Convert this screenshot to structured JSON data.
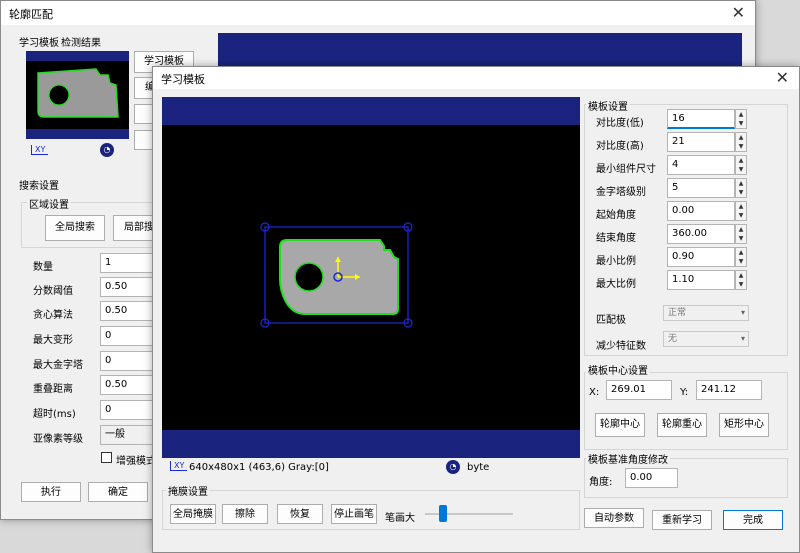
{
  "back_window": {
    "title": "轮廓匹配",
    "tabs": [
      "学习模板",
      "检测结果"
    ],
    "buttons": {
      "learn_template": "学习模板",
      "edit": "编"
    },
    "search_group": "搜索设置",
    "region_group": "区域设置",
    "global_search": "全局搜索",
    "local_search": "局部搜",
    "params": [
      {
        "label": "数量",
        "value": "1"
      },
      {
        "label": "分数阈值",
        "value": "0.50"
      },
      {
        "label": "贪心算法",
        "value": "0.50"
      },
      {
        "label": "最大变形",
        "value": "0"
      },
      {
        "label": "最大金字塔",
        "value": "0"
      },
      {
        "label": "重叠距离",
        "value": "0.50"
      },
      {
        "label": "超时(ms)",
        "value": "0"
      },
      {
        "label": "亚像素等级",
        "value": "一般"
      }
    ],
    "enhance_mode": "增强模式",
    "execute": "执行",
    "confirm": "确定"
  },
  "front_window": {
    "title": "学习模板",
    "status_text": "640x480x1 (463,6) Gray:[0]",
    "status_type": "byte",
    "mask_group": "掩膜设置",
    "mask_buttons": [
      "全局掩膜",
      "擦除",
      "恢复",
      "停止画笔"
    ],
    "pen_size_label": "笔画大",
    "template_group": "模板设置",
    "params": [
      {
        "label": "对比度(低)",
        "value": "16"
      },
      {
        "label": "对比度(高)",
        "value": "21"
      },
      {
        "label": "最小组件尺寸",
        "value": "4"
      },
      {
        "label": "金字塔级别",
        "value": "5"
      },
      {
        "label": "起始角度",
        "value": "0.00"
      },
      {
        "label": "结束角度",
        "value": "360.00"
      },
      {
        "label": "最小比例",
        "value": "0.90"
      },
      {
        "label": "最大比例",
        "value": "1.10"
      }
    ],
    "polarity_label": "匹配极",
    "polarity_value": "正常",
    "reduce_label": "减少特征数",
    "reduce_value": "无",
    "center_group": "模板中心设置",
    "x_label": "X:",
    "x_value": "269.01",
    "y_label": "Y:",
    "y_value": "241.12",
    "center_buttons": [
      "轮廓中心",
      "轮廓重心",
      "矩形中心"
    ],
    "angle_group": "模板基准角度修改",
    "angle_label": "角度:",
    "angle_value": "0.00",
    "auto_params": "自动参数",
    "relearn": "重新学习",
    "done": "完成",
    "pen_size_level": 0.2
  },
  "colors": {
    "canvas_band": "#1a237e",
    "contour": "#22dd22",
    "roi": "#1a2ad6",
    "accent_blue": "#0078d7"
  }
}
